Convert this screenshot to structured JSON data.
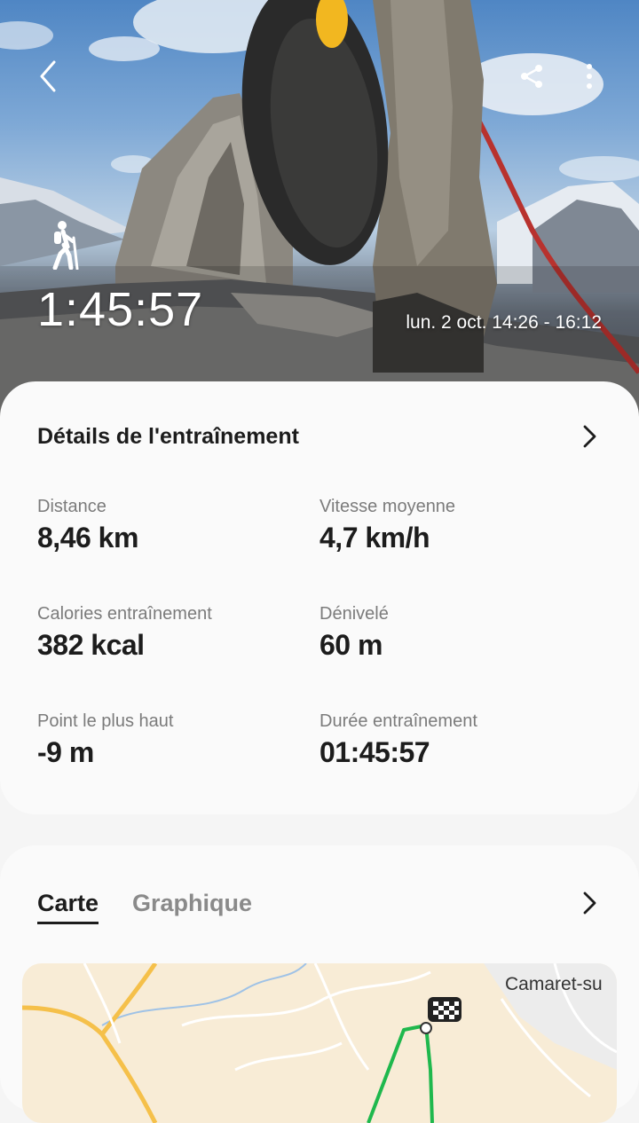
{
  "workout": {
    "duration": "1:45:57",
    "date_range": "lun. 2 oct. 14:26 - 16:12"
  },
  "details": {
    "title": "Détails de l'entraînement",
    "stats": [
      {
        "label": "Distance",
        "value": "8,46 km"
      },
      {
        "label": "Vitesse moyenne",
        "value": "4,7 km/h"
      },
      {
        "label": "Calories entraînement",
        "value": "382 kcal"
      },
      {
        "label": "Dénivelé",
        "value": "60 m"
      },
      {
        "label": "Point le plus haut",
        "value": "-9 m"
      },
      {
        "label": "Durée entraînement",
        "value": "01:45:57"
      }
    ]
  },
  "map_section": {
    "tabs": [
      "Carte",
      "Graphique"
    ],
    "place_label": "Camaret-su"
  },
  "icons": {
    "back": "chevron-left-icon",
    "share": "share-icon",
    "more": "more-vertical-icon",
    "activity": "hiking-icon",
    "chevron": "chevron-right-icon",
    "finish": "finish-flag-icon"
  },
  "colors": {
    "route": "#1fb84d",
    "card_bg": "#fafafa",
    "page_bg": "#f5f5f5",
    "text_primary": "#1c1c1c",
    "text_secondary": "#7b7b7b"
  }
}
